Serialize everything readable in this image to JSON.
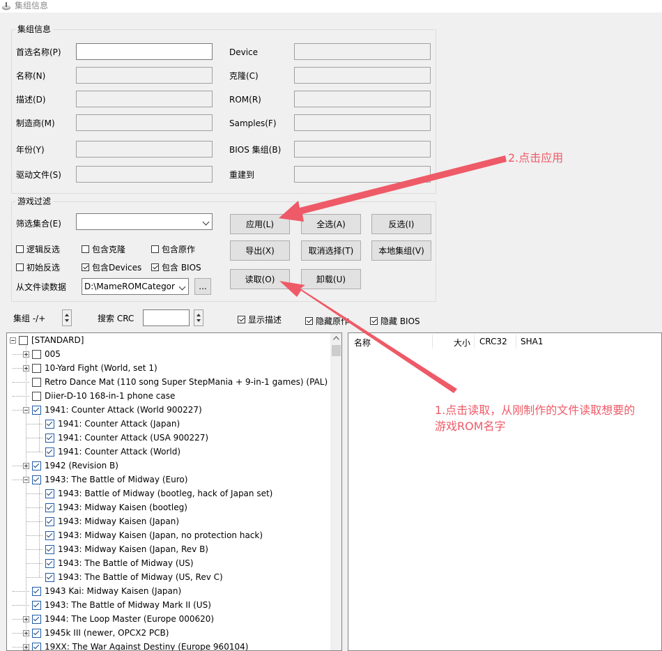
{
  "window": {
    "title": "集组信息"
  },
  "group_info": {
    "legend": "集组信息",
    "left_fields": [
      {
        "label": "首选名称(P)",
        "value": ""
      },
      {
        "label": "名称(N)",
        "value": ""
      },
      {
        "label": "描述(D)",
        "value": ""
      },
      {
        "label": "制造商(M)",
        "value": ""
      },
      {
        "label": "年份(Y)",
        "value": ""
      },
      {
        "label": "驱动文件(S)",
        "value": ""
      }
    ],
    "right_fields": [
      {
        "label": "Device",
        "value": ""
      },
      {
        "label": "克隆(C)",
        "value": ""
      },
      {
        "label": "ROM(R)",
        "value": ""
      },
      {
        "label": "Samples(F)",
        "value": ""
      },
      {
        "label": "BIOS 集组(B)",
        "value": ""
      },
      {
        "label": "重建到",
        "value": ""
      }
    ]
  },
  "game_filter": {
    "legend": "游戏过滤",
    "filter_set_label": "筛选集合(E)",
    "filter_set_value": "",
    "checkboxes": [
      {
        "label": "逻辑反选",
        "checked": false
      },
      {
        "label": "包含克隆",
        "checked": false
      },
      {
        "label": "包含原作",
        "checked": false
      },
      {
        "label": "初始反选",
        "checked": false
      },
      {
        "label": "包含Devices",
        "checked": true
      },
      {
        "label": "包含 BIOS",
        "checked": true
      }
    ],
    "read_from_file_label": "从文件读数据",
    "file_path": "D:\\MameROMCategor",
    "browse_label": "...",
    "buttons": {
      "apply": "应用(L)",
      "select_all": "全选(A)",
      "invert": "反选(I)",
      "export": "导出(X)",
      "deselect": "取消选择(T)",
      "local_set": "本地集组(V)",
      "read": "读取(O)",
      "unload": "卸载(U)"
    }
  },
  "toolbar_row": {
    "set_label": "集组 -/+",
    "crc_label": "搜索 CRC",
    "crc_value": "",
    "show_desc": {
      "label": "显示描述",
      "checked": true
    },
    "hide_original": {
      "label": "隐藏原作",
      "checked": true
    },
    "hide_bios": {
      "label": "隐藏 BIOS",
      "checked": true
    }
  },
  "tree": {
    "items": [
      {
        "text": "[STANDARD]",
        "level": 0,
        "expander": "minus",
        "checked": false
      },
      {
        "text": "005",
        "level": 1,
        "expander": "plus",
        "checked": false
      },
      {
        "text": "10-Yard Fight (World, set 1)",
        "level": 1,
        "expander": "plus",
        "checked": false
      },
      {
        "text": "Retro Dance Mat (110 song Super StepMania + 9-in-1 games) (PAL)",
        "level": 1,
        "expander": "",
        "checked": false
      },
      {
        "text": "Diier-D-10 168-in-1 phone case",
        "level": 1,
        "expander": "",
        "checked": false
      },
      {
        "text": "1941: Counter Attack (World 900227)",
        "level": 1,
        "expander": "minus",
        "checked": true
      },
      {
        "text": "1941: Counter Attack (Japan)",
        "level": 2,
        "expander": "",
        "checked": true
      },
      {
        "text": "1941: Counter Attack (USA 900227)",
        "level": 2,
        "expander": "",
        "checked": true
      },
      {
        "text": "1941: Counter Attack (World)",
        "level": 2,
        "expander": "",
        "checked": true
      },
      {
        "text": "1942 (Revision B)",
        "level": 1,
        "expander": "plus",
        "checked": true
      },
      {
        "text": "1943: The Battle of Midway (Euro)",
        "level": 1,
        "expander": "minus",
        "checked": true
      },
      {
        "text": "1943: Battle of Midway (bootleg, hack of Japan set)",
        "level": 2,
        "expander": "",
        "checked": true
      },
      {
        "text": "1943: Midway Kaisen (bootleg)",
        "level": 2,
        "expander": "",
        "checked": true
      },
      {
        "text": "1943: Midway Kaisen (Japan)",
        "level": 2,
        "expander": "",
        "checked": true
      },
      {
        "text": "1943: Midway Kaisen (Japan, no protection hack)",
        "level": 2,
        "expander": "",
        "checked": true
      },
      {
        "text": "1943: Midway Kaisen (Japan, Rev B)",
        "level": 2,
        "expander": "",
        "checked": true
      },
      {
        "text": "1943: The Battle of Midway (US)",
        "level": 2,
        "expander": "",
        "checked": true
      },
      {
        "text": "1943: The Battle of Midway (US, Rev C)",
        "level": 2,
        "expander": "",
        "checked": true
      },
      {
        "text": "1943 Kai: Midway Kaisen (Japan)",
        "level": 1,
        "expander": "",
        "checked": true
      },
      {
        "text": "1943: The Battle of Midway Mark II (US)",
        "level": 1,
        "expander": "",
        "checked": true
      },
      {
        "text": "1944: The Loop Master (Europe 000620)",
        "level": 1,
        "expander": "plus",
        "checked": true
      },
      {
        "text": "1945k III (newer, OPCX2 PCB)",
        "level": 1,
        "expander": "plus",
        "checked": true
      },
      {
        "text": "19XX: The War Against Destiny (Europe 960104)",
        "level": 1,
        "expander": "plus",
        "checked": true
      }
    ]
  },
  "rom_list": {
    "columns": [
      "名称",
      "大小",
      "CRC32",
      "SHA1"
    ]
  },
  "annotations": {
    "step2": "2.点击应用",
    "step1_line1": "1.点击读取，从刚制作的文件读取想要的",
    "step1_line2": "游戏ROM名字",
    "color": "#ee5a67"
  }
}
